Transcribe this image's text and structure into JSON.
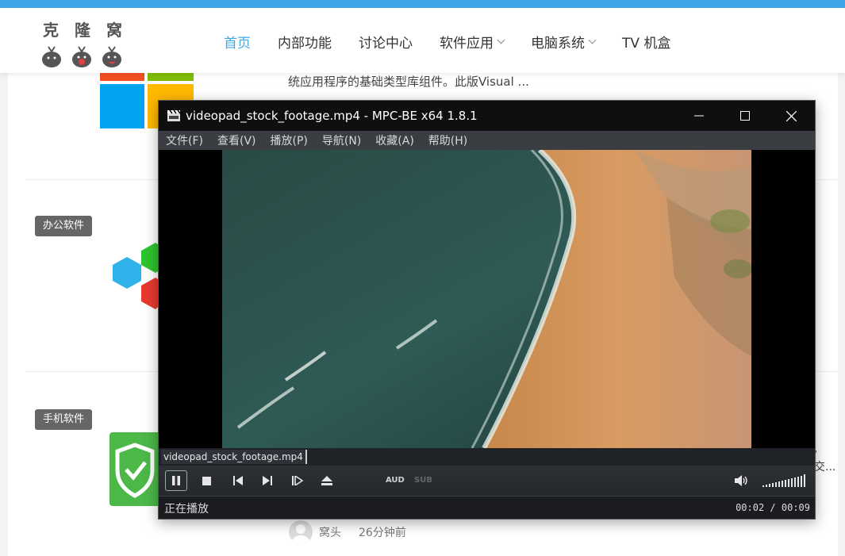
{
  "site": {
    "logo": {
      "chars": [
        "克",
        "隆",
        "窝"
      ]
    },
    "nav": [
      {
        "label": "首页",
        "active": true,
        "dropdown": false
      },
      {
        "label": "内部功能",
        "active": false,
        "dropdown": false
      },
      {
        "label": "讨论中心",
        "active": false,
        "dropdown": false
      },
      {
        "label": "软件应用",
        "active": false,
        "dropdown": true
      },
      {
        "label": "电脑系统",
        "active": false,
        "dropdown": true
      },
      {
        "label": "TV 机盒",
        "active": false,
        "dropdown": false
      }
    ],
    "snippet_text": "统应用程序的基础类型库组件。此版Visual ...",
    "categories": [
      {
        "label": "办公软件"
      },
      {
        "label": "手机软件"
      }
    ],
    "author": {
      "name": "窝头",
      "time": "26分钟前"
    },
    "right_edge_fragments": [
      ",",
      "交..."
    ],
    "accent_color": "#3fa7e8"
  },
  "player": {
    "title": "videopad_stock_footage.mp4 - MPC-BE x64 1.8.1",
    "menu": [
      "文件(F)",
      "查看(V)",
      "播放(P)",
      "导航(N)",
      "收藏(A)",
      "帮助(H)"
    ],
    "filename_tooltip": "videopad_stock_footage.mp4",
    "controls": {
      "aud_label": "AUD",
      "sub_label": "SUB"
    },
    "status": "正在播放",
    "time": "00:02 / 00:09",
    "playback_state": "playing"
  }
}
